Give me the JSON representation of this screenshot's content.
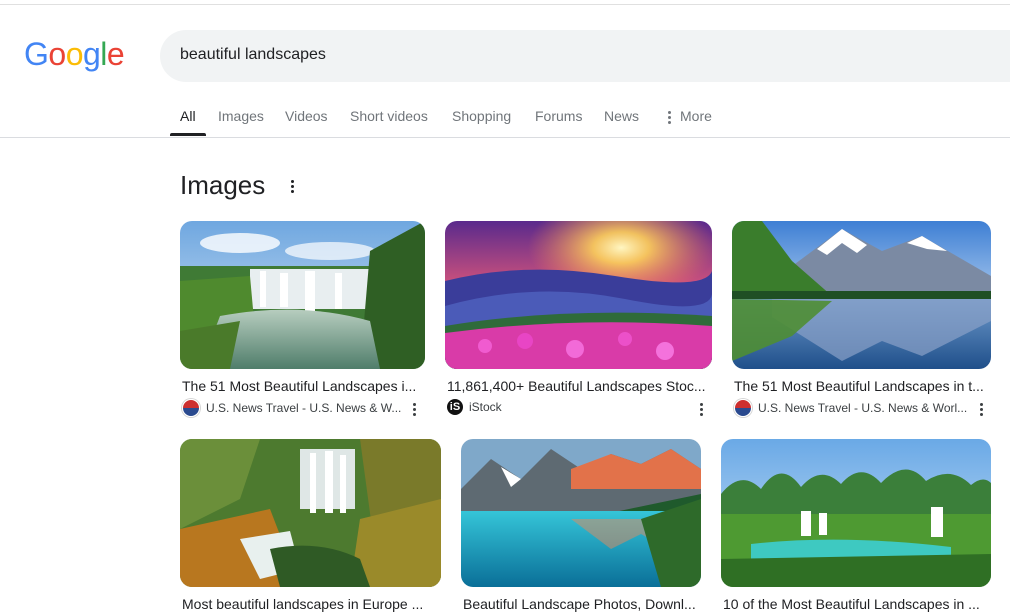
{
  "logo": {
    "letters": [
      "G",
      "o",
      "o",
      "g",
      "l",
      "e"
    ]
  },
  "colors": {
    "blue": "#4285f4",
    "red": "#ea4335",
    "yellow": "#fbbc05",
    "green": "#34a853"
  },
  "search": {
    "query": "beautiful landscapes"
  },
  "tabs": [
    {
      "label": "All",
      "active": true
    },
    {
      "label": "Images"
    },
    {
      "label": "Videos"
    },
    {
      "label": "Short videos"
    },
    {
      "label": "Shopping"
    },
    {
      "label": "Forums"
    },
    {
      "label": "News"
    },
    {
      "label": "More",
      "icon": "more-vert-icon"
    }
  ],
  "section": {
    "title": "Images"
  },
  "results": [
    {
      "caption": "The 51 Most Beautiful Landscapes i...",
      "source": "U.S. News Travel - U.S. News & W...",
      "favicon": "us-news-favicon"
    },
    {
      "caption": "11,861,400+ Beautiful Landscapes Stoc...",
      "source": "iStock",
      "favicon": "istock-favicon",
      "favicon_letter": "iS"
    },
    {
      "caption": "The 51 Most Beautiful Landscapes in t...",
      "source": "U.S. News Travel - U.S. News & Worl...",
      "favicon": "us-news-favicon"
    },
    {
      "caption": "Most beautiful landscapes in Europe ..."
    },
    {
      "caption": "Beautiful Landscape Photos, Downl..."
    },
    {
      "caption": "10 of the Most Beautiful Landscapes in ..."
    }
  ]
}
